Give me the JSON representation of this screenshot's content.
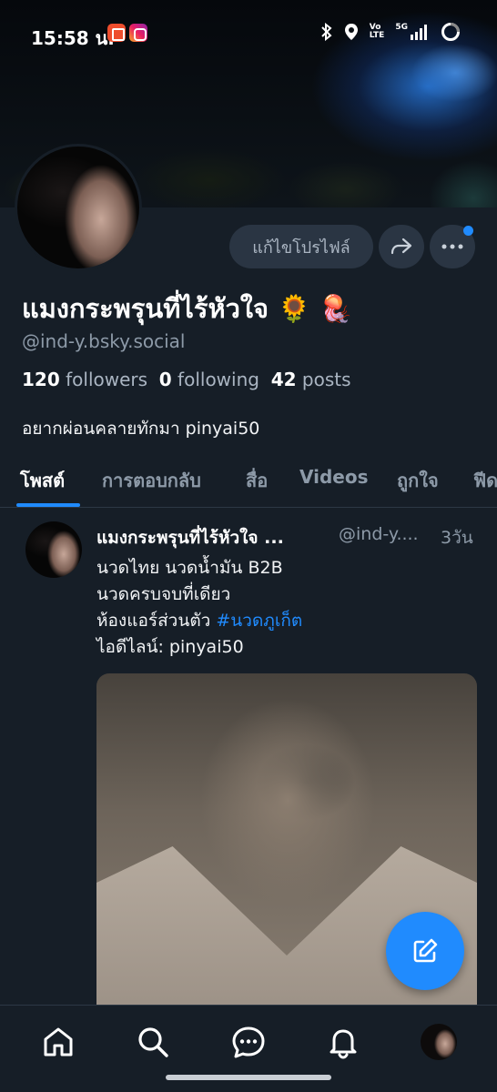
{
  "status_bar": {
    "time": "15:58 น.",
    "app_badges": [
      "shopee-icon",
      "instagram-icon"
    ],
    "network": {
      "volte_line1": "Vo",
      "volte_line2": "LTE",
      "generation": "5G"
    }
  },
  "profile": {
    "display_name": "แมงกระพรุนที่ไร้หัวใจ 🌻 🪼",
    "handle": "@ind-y.bsky.social",
    "followers_count": "120",
    "followers_label": "followers",
    "following_count": "0",
    "following_label": "following",
    "posts_count": "42",
    "posts_label": "posts",
    "bio": "อยากผ่อนคลายทักมา pinyai50",
    "edit_profile_label": "แก้ไขโปรไฟล์"
  },
  "tabs": [
    {
      "label": "โพสต์",
      "active": true
    },
    {
      "label": "การตอบกลับ",
      "active": false
    },
    {
      "label": "สื่อ",
      "active": false
    },
    {
      "label": "Videos",
      "active": false
    },
    {
      "label": "ถูกใจ",
      "active": false
    },
    {
      "label": "ฟีด",
      "active": false
    }
  ],
  "post": {
    "author_name": "แมงกระพรุนที่ไร้หัวใจ ...",
    "author_handle": "@ind-y....",
    "time": "3วัน",
    "line1": "นวดไทย นวดน้ำมัน B2B",
    "line2": "นวดครบจบที่เดียว",
    "line3_text": "ห้องแอร์ส่วนตัว ",
    "line3_tag": "#นวดภูเก็ต",
    "line4": "ไอดีไลน์: pinyai50"
  },
  "colors": {
    "background": "#161e27",
    "accent": "#208bfe",
    "button_bg": "#2a3543",
    "muted_text": "#8d9aa8"
  },
  "bottom_nav": [
    "home-icon",
    "search-icon",
    "chat-icon",
    "notifications-icon",
    "profile-avatar"
  ]
}
